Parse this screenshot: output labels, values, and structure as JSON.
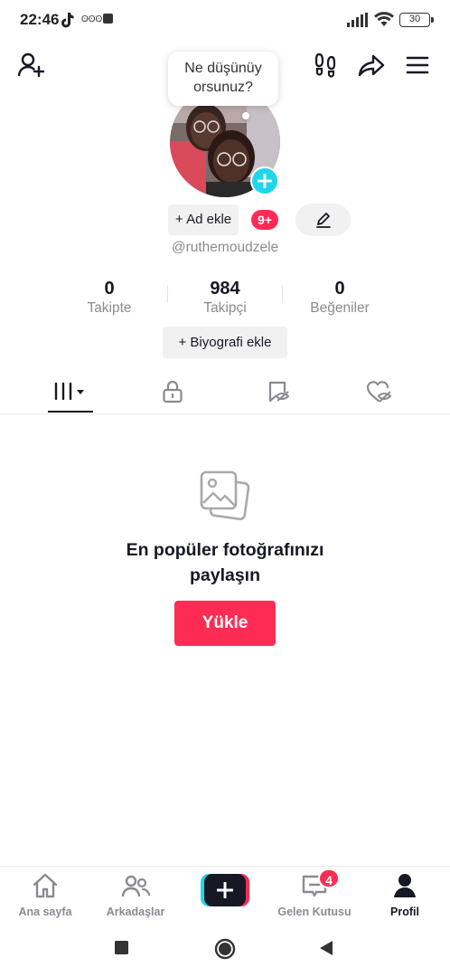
{
  "status_bar": {
    "time": "22:46",
    "network_label": "ʘʘʘ",
    "battery": "30"
  },
  "header": {
    "icons": [
      "add-friend-icon",
      "footprints-icon",
      "share-icon",
      "menu-icon"
    ]
  },
  "profile": {
    "note_bubble": "Ne düşünüy orsunuz?",
    "add_name_label": "+ Ad ekle",
    "notification_badge": "9+",
    "username": "@ruthemoudzele",
    "bio_button": "+ Biyografi ekle",
    "stats": [
      {
        "value": "0",
        "label": "Takipte"
      },
      {
        "value": "984",
        "label": "Takipçi"
      },
      {
        "value": "0",
        "label": "Beğeniler"
      }
    ]
  },
  "tabs": {
    "icons": [
      "grid-icon",
      "lock-icon",
      "bookmark-icon",
      "liked-icon"
    ],
    "active": 0
  },
  "empty_state": {
    "title_line1": "En popüler fotoğrafınızı",
    "title_line2": "paylaşın",
    "upload_label": "Yükle"
  },
  "bottom_nav": {
    "home": "Ana sayfa",
    "friends": "Arkadaşlar",
    "inbox": "Gelen Kutusu",
    "inbox_badge": "4",
    "profile": "Profil"
  },
  "colors": {
    "accent": "#fe2c55",
    "cyan": "#20d5ec",
    "text": "#161823",
    "muted": "#8a8b91"
  }
}
